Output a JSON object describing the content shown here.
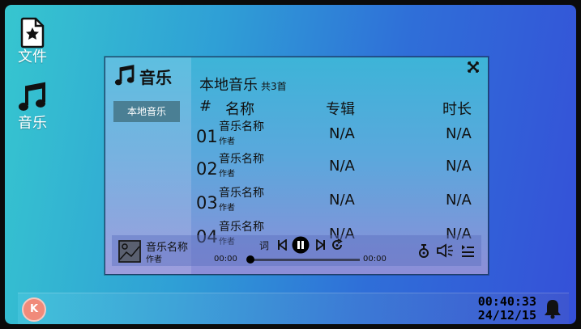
{
  "desktop": {
    "icons": [
      {
        "label": "文件",
        "icon": "file-star-icon"
      },
      {
        "label": "音乐",
        "icon": "music-note-icon"
      }
    ]
  },
  "window": {
    "app_title": "音乐",
    "sidebar": {
      "items": [
        {
          "label": "本地音乐"
        }
      ]
    },
    "heading": "本地音乐",
    "count": "共3首",
    "columns": {
      "num": "#",
      "name": "名称",
      "album": "专辑",
      "duration": "时长"
    },
    "rows": [
      {
        "num": "01",
        "name": "音乐名称",
        "artist": "作者",
        "album": "N/A",
        "duration": "N/A"
      },
      {
        "num": "02",
        "name": "音乐名称",
        "artist": "作者",
        "album": "N/A",
        "duration": "N/A"
      },
      {
        "num": "03",
        "name": "音乐名称",
        "artist": "作者",
        "album": "N/A",
        "duration": "N/A"
      },
      {
        "num": "04",
        "name": "音乐名称",
        "artist": "作者",
        "album": "N/A",
        "duration": "N/A"
      }
    ],
    "player": {
      "title": "音乐名称",
      "artist": "作者",
      "lyrics_label": "词",
      "current_time": "00:00",
      "total_time": "00:00",
      "progress": 0
    }
  },
  "taskbar": {
    "start_label": "K",
    "time": "00:40:33",
    "date": "24/12/15"
  },
  "colors": {
    "accent": "#4a7f94",
    "start_button": "#f08a7a"
  }
}
